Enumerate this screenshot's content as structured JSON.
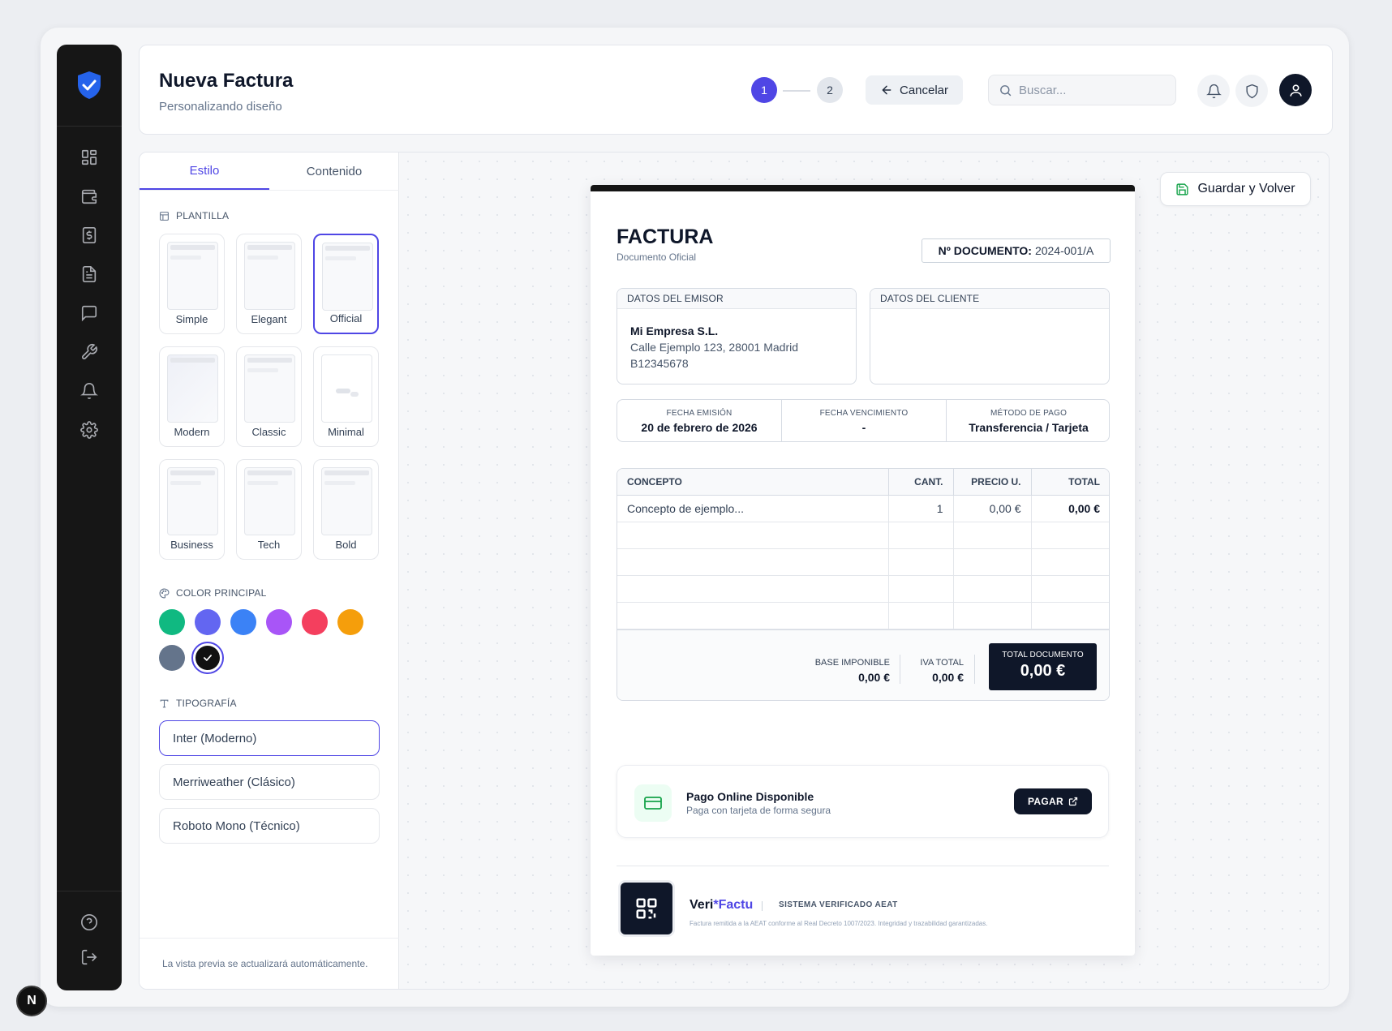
{
  "header": {
    "title": "Nueva Factura",
    "subtitle": "Personalizando diseño",
    "steps": [
      "1",
      "2"
    ],
    "cancel_label": "Cancelar",
    "search_placeholder": "Buscar..."
  },
  "panel": {
    "tabs": [
      "Estilo",
      "Contenido"
    ],
    "template_section": "PLANTILLA",
    "templates": [
      {
        "label": "Simple",
        "selected": false
      },
      {
        "label": "Elegant",
        "selected": false
      },
      {
        "label": "Official",
        "selected": true
      },
      {
        "label": "Modern",
        "selected": false
      },
      {
        "label": "Classic",
        "selected": false
      },
      {
        "label": "Minimal",
        "selected": false
      },
      {
        "label": "Business",
        "selected": false
      },
      {
        "label": "Tech",
        "selected": false
      },
      {
        "label": "Bold",
        "selected": false
      }
    ],
    "color_section": "COLOR PRINCIPAL",
    "colors": [
      "#10b981",
      "#6366f1",
      "#3b82f6",
      "#a855f7",
      "#f43f5e",
      "#f59e0b",
      "#64748b",
      "#111111"
    ],
    "selected_color": "#111111",
    "typography_section": "TIPOGRAFÍA",
    "fonts": [
      {
        "label": "Inter (Moderno)",
        "selected": true
      },
      {
        "label": "Merriweather (Clásico)",
        "selected": false
      },
      {
        "label": "Roboto Mono (Técnico)",
        "selected": false
      }
    ],
    "footer_note": "La vista previa se actualizará automáticamente."
  },
  "toolbar": {
    "save_label": "Guardar y Volver"
  },
  "invoice": {
    "title": "FACTURA",
    "subtitle": "Documento Oficial",
    "doc_number_label": "Nº DOCUMENTO:",
    "doc_number": "2024-001/A",
    "emisor_header": "DATOS DEL EMISOR",
    "emisor_name": "Mi Empresa S.L.",
    "emisor_address": "Calle Ejemplo 123, 28001 Madrid",
    "emisor_nif": "B12345678",
    "cliente_header": "DATOS DEL CLIENTE",
    "meta": [
      {
        "label": "FECHA EMISIÓN",
        "value": "20 de febrero de 2026"
      },
      {
        "label": "FECHA VENCIMIENTO",
        "value": "-"
      },
      {
        "label": "MÉTODO DE PAGO",
        "value": "Transferencia / Tarjeta"
      }
    ],
    "columns": [
      "CONCEPTO",
      "CANT.",
      "PRECIO U.",
      "TOTAL"
    ],
    "rows": [
      {
        "concepto": "Concepto de ejemplo...",
        "cant": "1",
        "precio": "0,00 €",
        "total": "0,00 €"
      }
    ],
    "base_label": "BASE IMPONIBLE",
    "base_value": "0,00 €",
    "iva_label": "IVA TOTAL",
    "iva_value": "0,00 €",
    "total_label": "TOTAL DOCUMENTO",
    "total_value": "0,00 €",
    "pay_title": "Pago Online Disponible",
    "pay_subtitle": "Paga con tarjeta de forma segura",
    "pay_button": "PAGAR",
    "verifactu_a": "Veri",
    "verifactu_b": "*Factu",
    "verifactu_system": "SISTEMA VERIFICADO AEAT",
    "verifactu_note": "Factura remitida a la AEAT conforme al Real Decreto 1007/2023. Integridad y trazabilidad garantizadas."
  },
  "badge": "N"
}
